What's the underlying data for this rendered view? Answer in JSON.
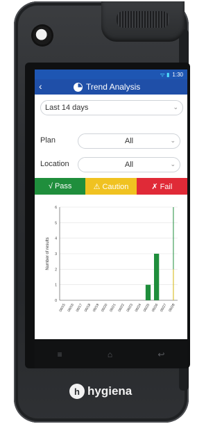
{
  "status_bar": {
    "wifi_icon": "wifi-icon",
    "time": "1:30"
  },
  "header": {
    "title": "Trend Analysis",
    "back_icon": "chevron-left-icon",
    "title_icon": "pie-chart-icon"
  },
  "filters": {
    "date_range": "Last 14 days",
    "plan": {
      "label": "Plan",
      "value": "All"
    },
    "location": {
      "label": "Location",
      "value": "All"
    }
  },
  "result_tabs": {
    "pass": "√ Pass",
    "caution": "⚠ Caution",
    "fail": "✗ Fail",
    "colors": {
      "pass": "#1f8e3c",
      "caution": "#f0c221",
      "fail": "#e02a37"
    }
  },
  "chart_data": {
    "type": "bar",
    "ylabel": "Number of results",
    "ylim": [
      0,
      6
    ],
    "yticks": [
      "0",
      "1",
      "2",
      "3",
      "4",
      "5",
      "6"
    ],
    "categories": [
      "06/15",
      "06/16",
      "06/17",
      "06/18",
      "06/19",
      "06/20",
      "06/21",
      "06/22",
      "06/23",
      "06/24",
      "06/25",
      "06/26",
      "06/27",
      "06/28"
    ],
    "series": [
      {
        "color": "#1f8e3c",
        "values": [
          0,
          0,
          0,
          0,
          0,
          0,
          0,
          0,
          0,
          0,
          1,
          3,
          0,
          0
        ]
      }
    ],
    "marker": {
      "category": "06/28",
      "value": 6
    }
  },
  "branding": {
    "logo_text": "hygiena"
  }
}
